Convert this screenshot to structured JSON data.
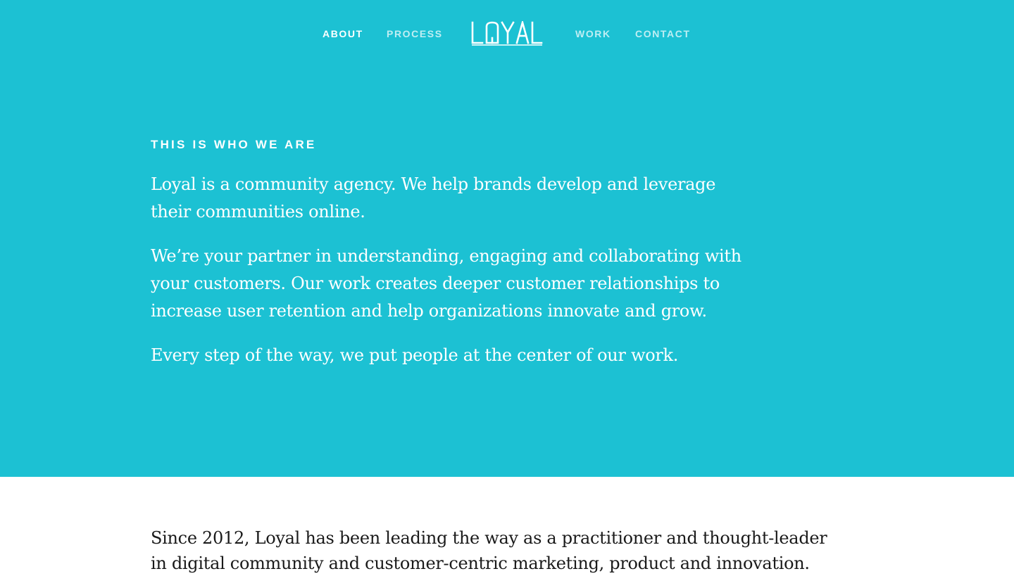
{
  "brand": {
    "logo_text": "LOYAL",
    "hero_color": "#1cc1d3"
  },
  "nav": {
    "items": [
      {
        "label": "ABOUT",
        "active": true
      },
      {
        "label": "PROCESS",
        "active": false
      },
      {
        "label": "WORK",
        "active": false
      },
      {
        "label": "CONTACT",
        "active": false
      }
    ]
  },
  "hero": {
    "eyebrow": "THIS IS WHO WE ARE",
    "paragraphs": [
      "Loyal is a community agency. We help brands develop and leverage their communities online.",
      "We’re your partner in understanding, engaging and collaborating with your customers. Our work creates deeper customer relationships to increase user retention and help organizations innovate and grow.",
      "Every step of the way, we put people at the center of our work."
    ]
  },
  "lower": {
    "paragraph": "Since 2012, Loyal has been leading the way as a practitioner and thought-leader in digital community and customer-centric marketing, product and innovation."
  }
}
